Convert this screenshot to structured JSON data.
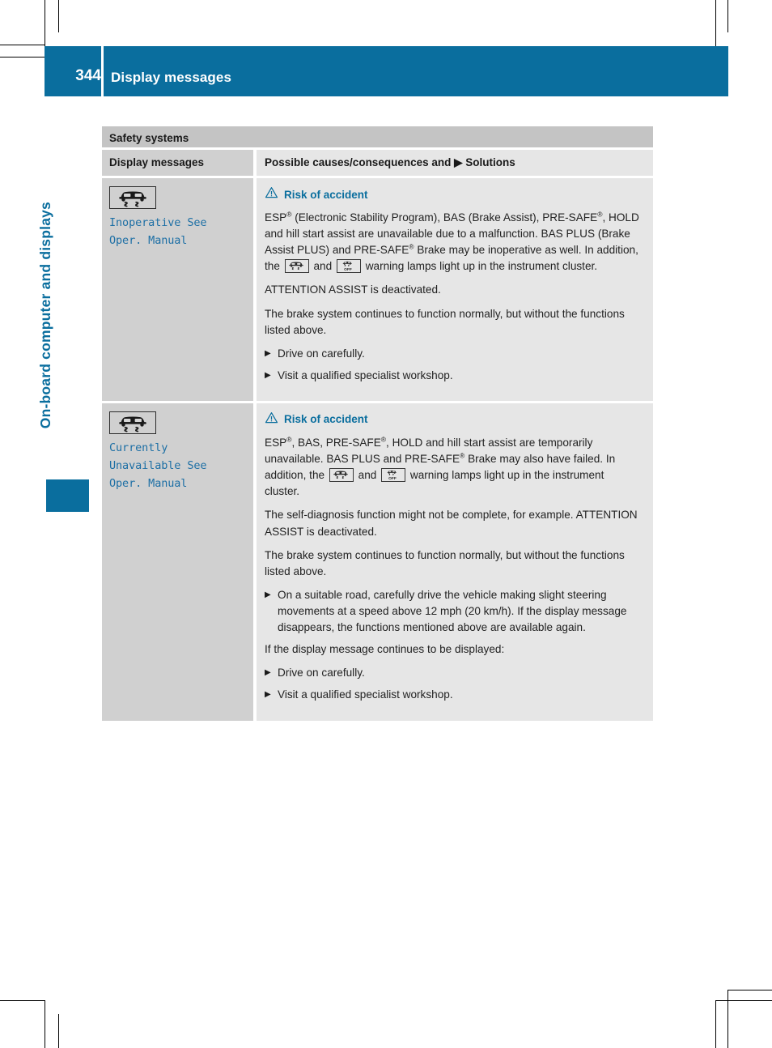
{
  "header": {
    "page_number": "344",
    "title": "Display messages",
    "accent_color": "#0a6e9e"
  },
  "chapter": {
    "label": "On-board computer and displays"
  },
  "table": {
    "section_title": "Safety systems",
    "columns": {
      "left": "Display messages",
      "right": "Possible causes/consequences and ▶ Solutions"
    },
    "rows": [
      {
        "message": {
          "icon": "esp-car-skid-icon",
          "text": "Inoperative See\nOper. Manual"
        },
        "warning": {
          "icon": "warning-triangle-icon",
          "title": "Risk of accident"
        },
        "blocks": [
          {
            "type": "paragraph",
            "id": "p1",
            "segments": [
              {
                "t": "text",
                "v": "ESP"
              },
              {
                "t": "sup",
                "v": "®"
              },
              {
                "t": "text",
                "v": " (Electronic Stability Program), BAS (Brake Assist), PRE-SAFE"
              },
              {
                "t": "sup",
                "v": "®"
              },
              {
                "t": "text",
                "v": ", HOLD and hill start assist are unavailable due to a malfunction. BAS PLUS (Brake Assist PLUS) and PRE-SAFE"
              },
              {
                "t": "sup",
                "v": "®"
              },
              {
                "t": "text",
                "v": " Brake may be inoperative as well. In addition, the "
              },
              {
                "t": "icon",
                "v": "esp-warning-lamp-icon"
              },
              {
                "t": "text",
                "v": " and "
              },
              {
                "t": "icon",
                "v": "esp-off-warning-lamp-icon"
              },
              {
                "t": "text",
                "v": " warning lamps light up in the instrument cluster."
              }
            ]
          },
          {
            "type": "paragraph",
            "id": "p2",
            "segments": [
              {
                "t": "text",
                "v": "ATTENTION ASSIST is deactivated."
              }
            ]
          },
          {
            "type": "paragraph",
            "id": "p3",
            "segments": [
              {
                "t": "text",
                "v": "The brake system continues to function normally, but without the functions listed above."
              }
            ]
          },
          {
            "type": "bullet",
            "id": "b1",
            "segments": [
              {
                "t": "text",
                "v": "Drive on carefully."
              }
            ]
          },
          {
            "type": "bullet",
            "id": "b2",
            "segments": [
              {
                "t": "text",
                "v": "Visit a qualified specialist workshop."
              }
            ]
          }
        ]
      },
      {
        "message": {
          "icon": "esp-car-skid-icon",
          "text": "Currently\nUnavailable See\nOper. Manual"
        },
        "warning": {
          "icon": "warning-triangle-icon",
          "title": "Risk of accident"
        },
        "blocks": [
          {
            "type": "paragraph",
            "id": "p1",
            "segments": [
              {
                "t": "text",
                "v": "ESP"
              },
              {
                "t": "sup",
                "v": "®"
              },
              {
                "t": "text",
                "v": ", BAS, PRE-SAFE"
              },
              {
                "t": "sup",
                "v": "®"
              },
              {
                "t": "text",
                "v": ", HOLD and hill start assist are temporarily unavailable. BAS PLUS and PRE-SAFE"
              },
              {
                "t": "sup",
                "v": "®"
              },
              {
                "t": "text",
                "v": " Brake may also have failed. In addition, the "
              },
              {
                "t": "icon",
                "v": "esp-warning-lamp-icon"
              },
              {
                "t": "text",
                "v": " and "
              },
              {
                "t": "icon",
                "v": "esp-off-warning-lamp-icon"
              },
              {
                "t": "text",
                "v": " warning lamps light up in the instrument cluster."
              }
            ]
          },
          {
            "type": "paragraph",
            "id": "p2",
            "segments": [
              {
                "t": "text",
                "v": "The self-diagnosis function might not be complete, for example. ATTENTION ASSIST is deactivated."
              }
            ]
          },
          {
            "type": "paragraph",
            "id": "p3",
            "segments": [
              {
                "t": "text",
                "v": "The brake system continues to function normally, but without the functions listed above."
              }
            ]
          },
          {
            "type": "bullet",
            "id": "b1",
            "segments": [
              {
                "t": "text",
                "v": "On a suitable road, carefully drive the vehicle making slight steering movements at a speed above 12 mph (20 km/h). If the display message disappears, the functions mentioned above are available again."
              }
            ]
          },
          {
            "type": "paragraph",
            "id": "p4",
            "segments": [
              {
                "t": "text",
                "v": "If the display message continues to be displayed:"
              }
            ]
          },
          {
            "type": "bullet",
            "id": "b2",
            "segments": [
              {
                "t": "text",
                "v": "Drive on carefully."
              }
            ]
          },
          {
            "type": "bullet",
            "id": "b3",
            "segments": [
              {
                "t": "text",
                "v": "Visit a qualified specialist workshop."
              }
            ]
          }
        ]
      }
    ]
  }
}
